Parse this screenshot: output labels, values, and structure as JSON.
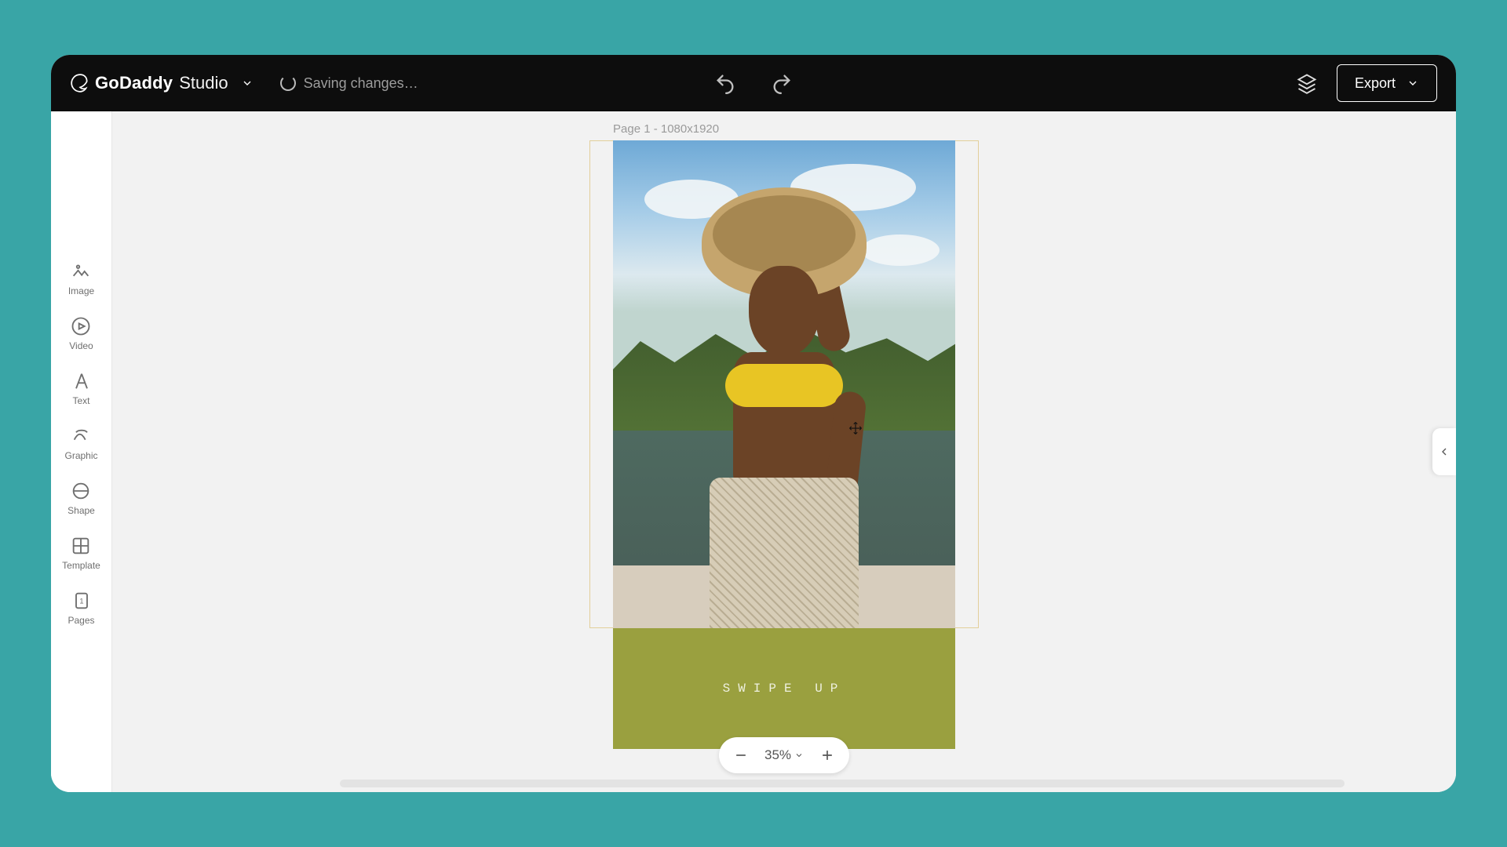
{
  "topbar": {
    "logo_main": "GoDaddy",
    "logo_sub": "Studio",
    "status": "Saving changes…",
    "export_label": "Export"
  },
  "sidebar": {
    "items": [
      {
        "label": "Image"
      },
      {
        "label": "Video"
      },
      {
        "label": "Text"
      },
      {
        "label": "Graphic"
      },
      {
        "label": "Shape"
      },
      {
        "label": "Template"
      },
      {
        "label": "Pages"
      }
    ]
  },
  "canvas": {
    "page_label": "Page 1 - 1080x1920",
    "banner_text": "SWIPE UP",
    "colors": {
      "banner_bg": "#9aa03f",
      "top_garment": "#e8c524",
      "selection": "#e2cf9a"
    }
  },
  "zoom": {
    "value": "35%"
  }
}
